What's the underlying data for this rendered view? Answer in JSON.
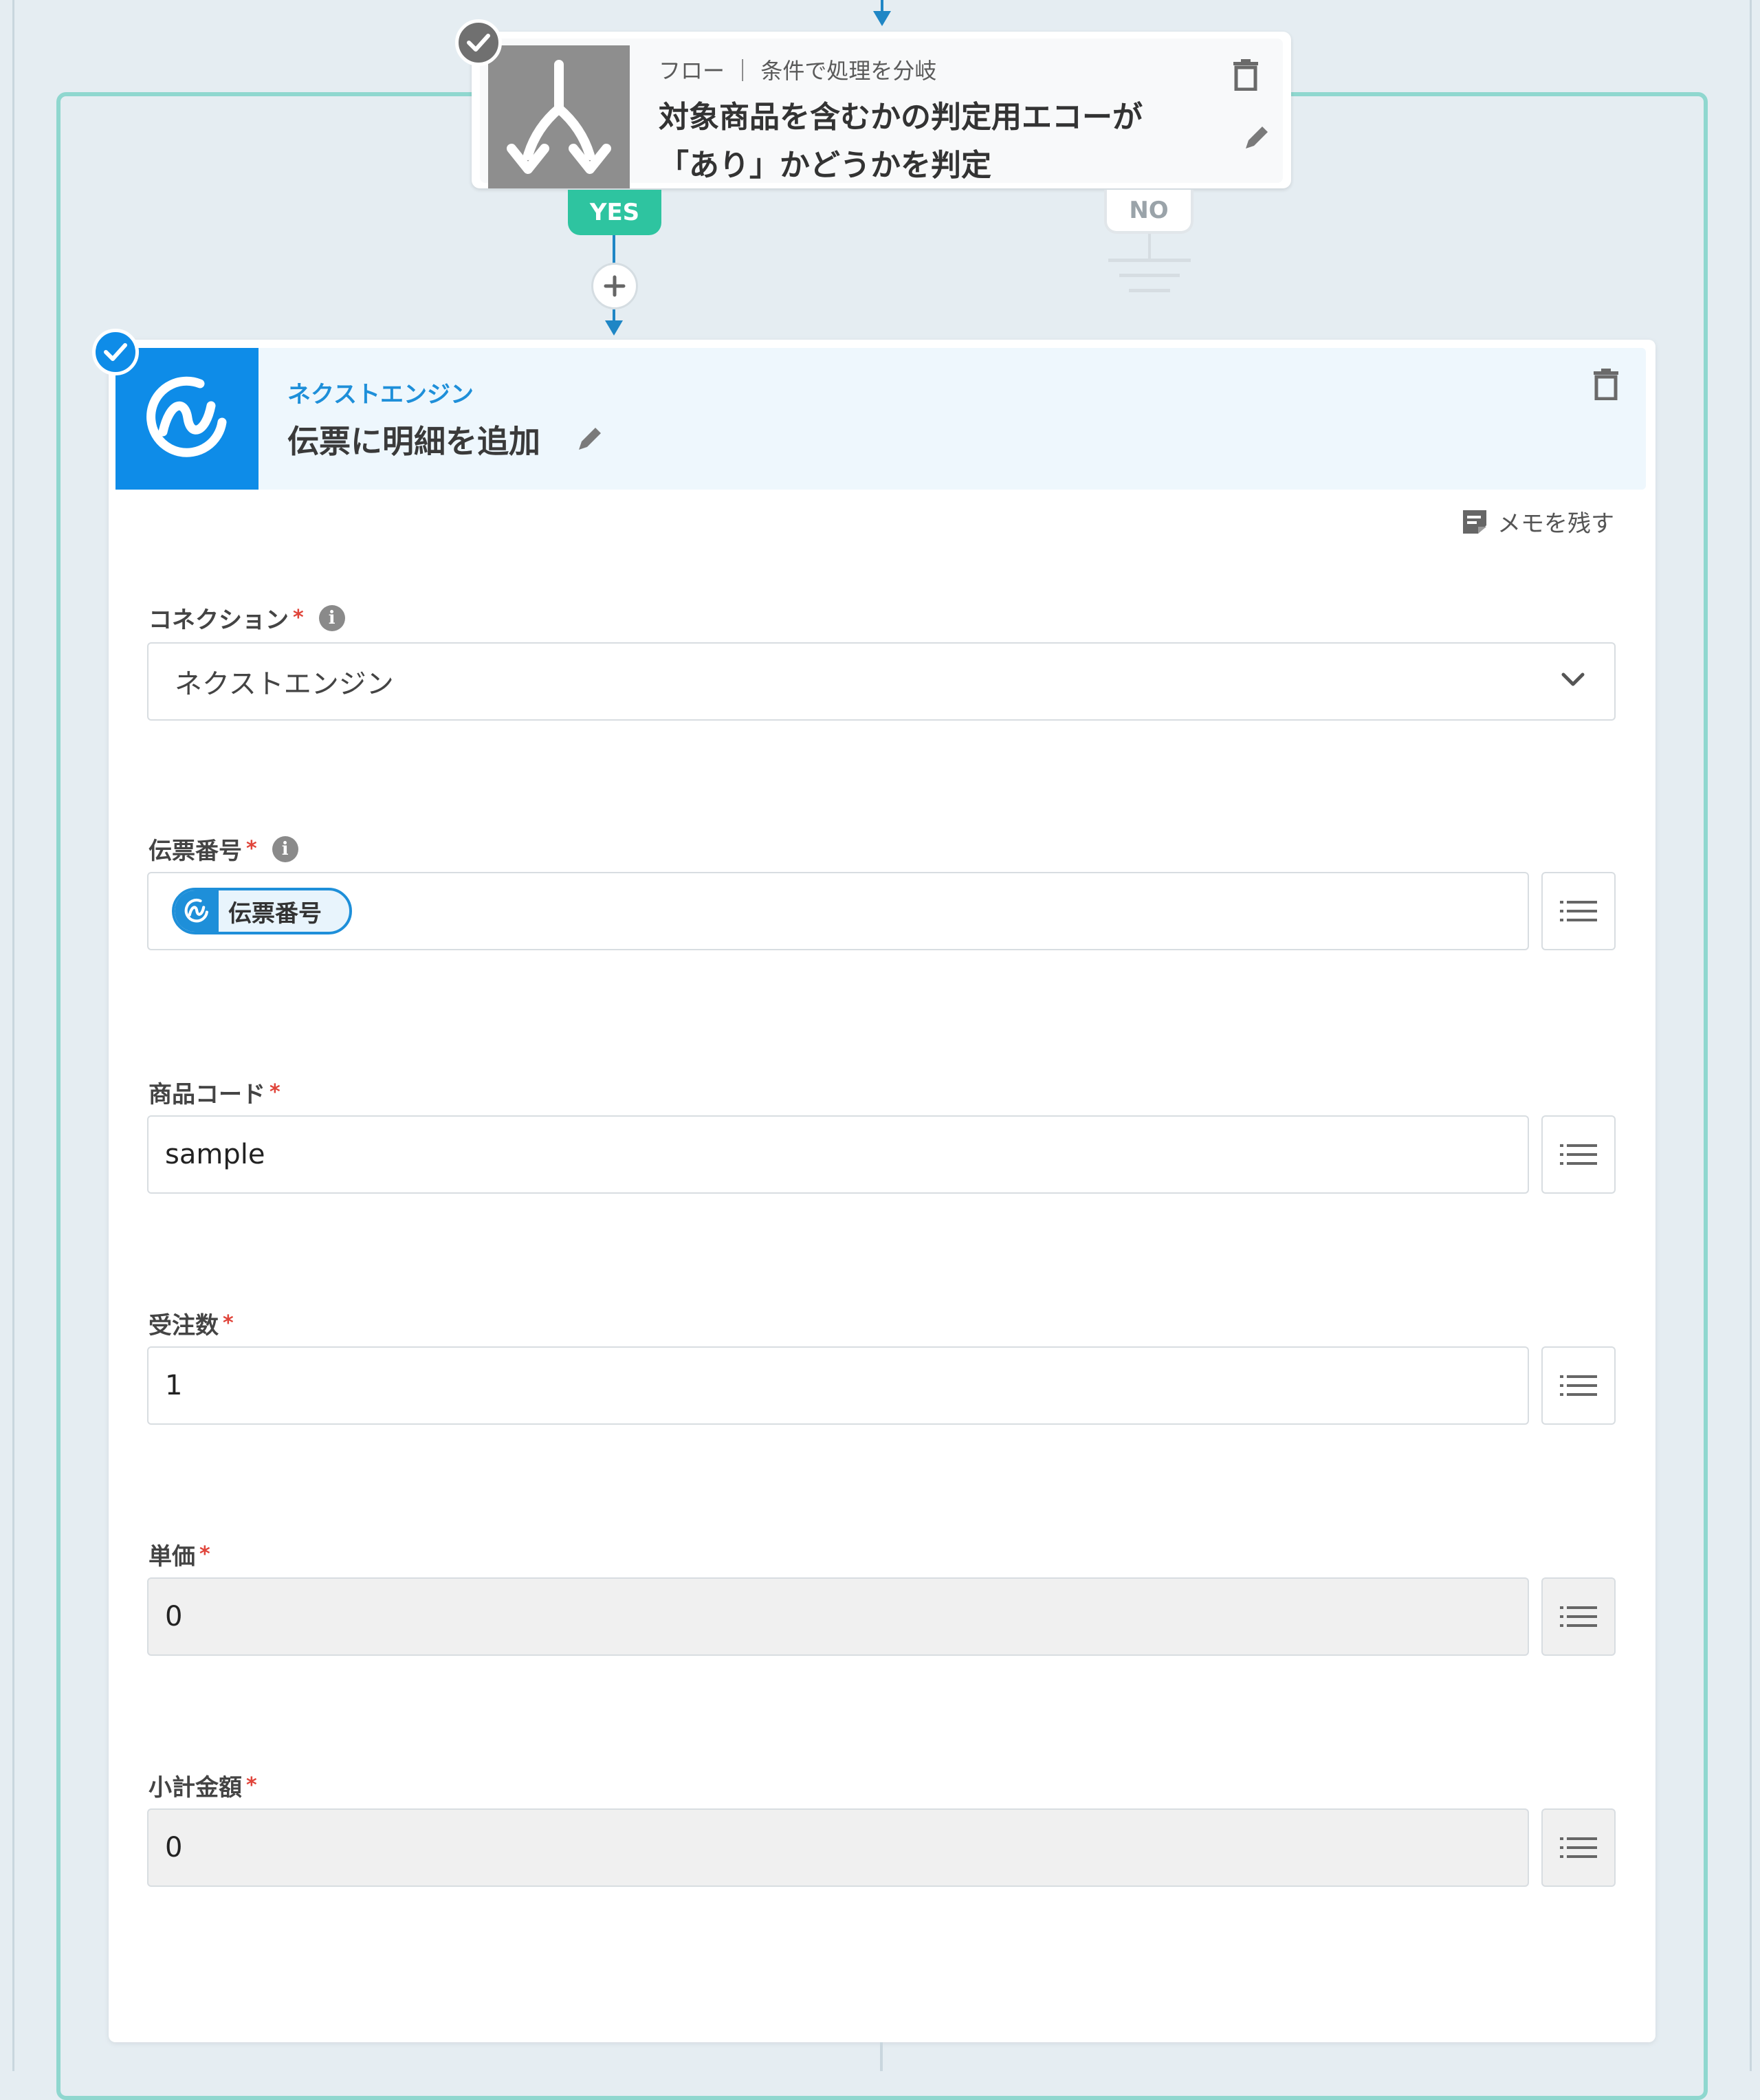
{
  "condition": {
    "category": "フロー ｜ 条件で処理を分岐",
    "title_line1": "対象商品を含むかの判定用エコーが",
    "title_line2": "「あり」かどうかを判定",
    "yes_label": "YES",
    "no_label": "NO"
  },
  "action": {
    "app_name": "ネクストエンジン",
    "title": "伝票に明細を追加",
    "memo_label": "メモを残す",
    "fields": {
      "connection": {
        "label": "コネクション",
        "required": "*",
        "value": "ネクストエンジン"
      },
      "slip_number": {
        "label": "伝票番号",
        "required": "*",
        "chip_label": "伝票番号"
      },
      "product_code": {
        "label": "商品コード",
        "required": "*",
        "value": "sample"
      },
      "order_quantity": {
        "label": "受注数",
        "required": "*",
        "value": "1"
      },
      "unit_price": {
        "label": "単価",
        "required": "*",
        "value": "0"
      },
      "subtotal": {
        "label": "小計金額",
        "required": "*",
        "value": "0"
      }
    }
  },
  "icons": {
    "condition": "branch-arrows-icon",
    "app": "next-engine-logo-icon",
    "delete": "trash-icon",
    "edit": "pencil-icon",
    "memo": "memo-icon",
    "info": "info-icon",
    "list": "list-icon",
    "check": "check-icon"
  },
  "colors": {
    "accent_blue": "#0e8ce8",
    "yes_green": "#2ec4a0",
    "branch_frame": "#8fd7cf",
    "required_red": "#e0443a",
    "check_grey": "#707070"
  }
}
